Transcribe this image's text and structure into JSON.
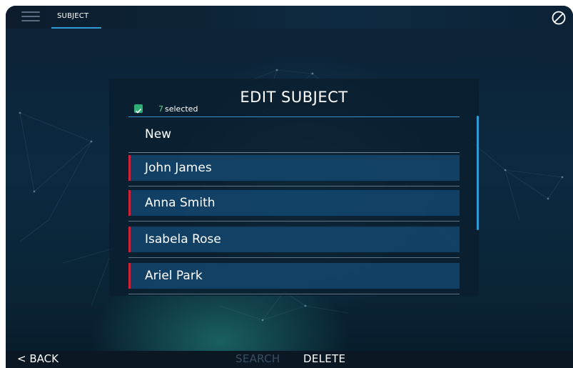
{
  "topbar": {
    "menu_icon": "hamburger-menu-icon",
    "tab_label": "SUBJECT",
    "right_icon": "block-icon"
  },
  "dialog": {
    "title": "EDIT SUBJECT",
    "selected_count": "7",
    "selected_suffix": "selected",
    "new_label": "New",
    "subjects": [
      {
        "name": "John James"
      },
      {
        "name": "Anna Smith"
      },
      {
        "name": "Isabela Rose"
      },
      {
        "name": "Ariel Park"
      }
    ]
  },
  "bottombar": {
    "back_label": "< BACK",
    "search_label": "SEARCH",
    "delete_label": "DELETE"
  },
  "colors": {
    "accent": "#2e9bd6",
    "selection_marker": "#d0233a",
    "check": "#2fae76",
    "row_bg": "#14466e"
  }
}
